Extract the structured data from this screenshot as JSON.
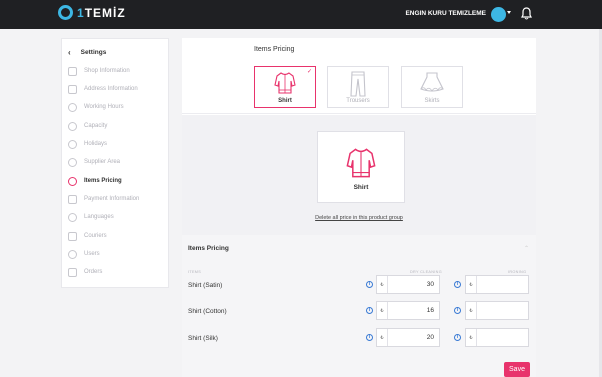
{
  "brand": {
    "logo_one": "1",
    "logo_text": "TEMİZ"
  },
  "header": {
    "user_name": "ENGIN KURU TEMIZLEME"
  },
  "sidebar": {
    "title": "Settings",
    "items": [
      {
        "label": "Shop Information",
        "icon": "shop-icon"
      },
      {
        "label": "Address Information",
        "icon": "address-icon"
      },
      {
        "label": "Working Hours",
        "icon": "clock-icon"
      },
      {
        "label": "Capacity",
        "icon": "capacity-icon"
      },
      {
        "label": "Holidays",
        "icon": "holiday-icon"
      },
      {
        "label": "Supplier Area",
        "icon": "location-icon"
      },
      {
        "label": "Items Pricing",
        "icon": "pricing-icon",
        "active": true
      },
      {
        "label": "Payment Information",
        "icon": "card-icon"
      },
      {
        "label": "Languages",
        "icon": "languages-icon"
      },
      {
        "label": "Couriers",
        "icon": "truck-icon"
      },
      {
        "label": "Users",
        "icon": "users-icon"
      },
      {
        "label": "Orders",
        "icon": "cart-icon"
      }
    ]
  },
  "items_section": {
    "title": "Items Pricing",
    "categories": [
      {
        "label": "Shirt",
        "selected": true
      },
      {
        "label": "Trousers",
        "selected": false
      },
      {
        "label": "Skirts",
        "selected": false
      }
    ],
    "selected_product": "Shirt",
    "delete_link": "Delete all price in this product group"
  },
  "pricing": {
    "title": "Items Pricing",
    "columns": {
      "items": "ITEMS",
      "dry_cleaning": "DRY CLEANING",
      "ironing": "IRONING"
    },
    "currency": "₺",
    "rows": [
      {
        "label": "Shirt (Satin)",
        "dry_cleaning": "30",
        "ironing": ""
      },
      {
        "label": "Shirt (Cotton)",
        "dry_cleaning": "16",
        "ironing": ""
      },
      {
        "label": "Shirt (Silk)",
        "dry_cleaning": "20",
        "ironing": ""
      }
    ],
    "save_label": "Save"
  },
  "colors": {
    "accent": "#e8336c",
    "brand": "#3db7e4",
    "topbar": "#1f2023",
    "info": "#3a7bd5"
  }
}
